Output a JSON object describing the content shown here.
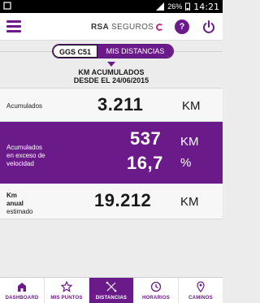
{
  "status_bar": {
    "battery": "26%",
    "time": "14:21"
  },
  "header": {
    "logo_bold": "RSA",
    "logo_rest": "SEGUROS",
    "help_label": "?"
  },
  "toggle": {
    "vehicle": "GGS C51",
    "section": "MIS DISTANCIAS"
  },
  "heading": {
    "line1": "KM ACUMULADOS",
    "line2": "DESDE EL 24/06/2015"
  },
  "metrics": {
    "accumulated": {
      "label": "Acumulados",
      "value": "3.211",
      "unit": "KM"
    },
    "speeding": {
      "label_line1": "Acumulados",
      "label_line2": "en exceso de",
      "label_line3": "velocidad",
      "km_value": "537",
      "km_unit": "KM",
      "pct_value": "16,7",
      "pct_unit": "%"
    },
    "annual": {
      "label_line1": "Km",
      "label_line2": "anual",
      "label_line3": "estimado",
      "value": "19.212",
      "unit": "KM"
    }
  },
  "bottom_nav": {
    "items": [
      {
        "label": "DASHBOARD",
        "icon": "house-icon"
      },
      {
        "label": "MIS PUNTOS",
        "icon": "star-icon"
      },
      {
        "label": "DISTANCIAS",
        "icon": "route-icon",
        "active": true
      },
      {
        "label": "HORARIOS",
        "icon": "clock-icon"
      },
      {
        "label": "CAMINOS",
        "icon": "map-pin-icon"
      }
    ]
  },
  "colors": {
    "brand_purple": "#6b1a8a",
    "accent_pink": "#c62a86"
  }
}
